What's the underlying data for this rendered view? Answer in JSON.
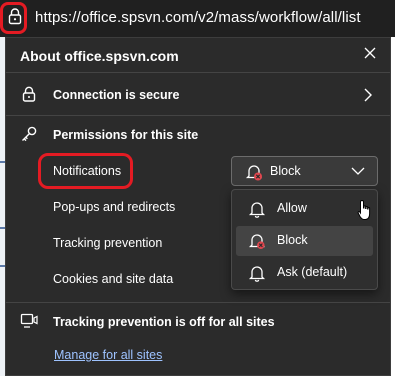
{
  "address_bar": {
    "url": "https://office.spsvn.com/v2/mass/workflow/all/list"
  },
  "popup": {
    "title": "About office.spsvn.com",
    "connection": "Connection is secure",
    "permissions_heading": "Permissions for this site",
    "permissions": [
      {
        "label": "Notifications"
      },
      {
        "label": "Pop-ups and redirects"
      },
      {
        "label": "Tracking prevention"
      },
      {
        "label": "Cookies and site data"
      }
    ],
    "notifications_select": {
      "value": "Block",
      "options": [
        "Allow",
        "Block",
        "Ask (default)"
      ],
      "selected_index": 1
    },
    "tracking_notice": "Tracking prevention is off for all sites",
    "manage_link": "Manage for all sites"
  },
  "colors": {
    "highlight_ring": "#e41b23",
    "popup_bg": "#2b2b2b",
    "link": "#9ec3ff",
    "block_badge": "#e0464e"
  }
}
